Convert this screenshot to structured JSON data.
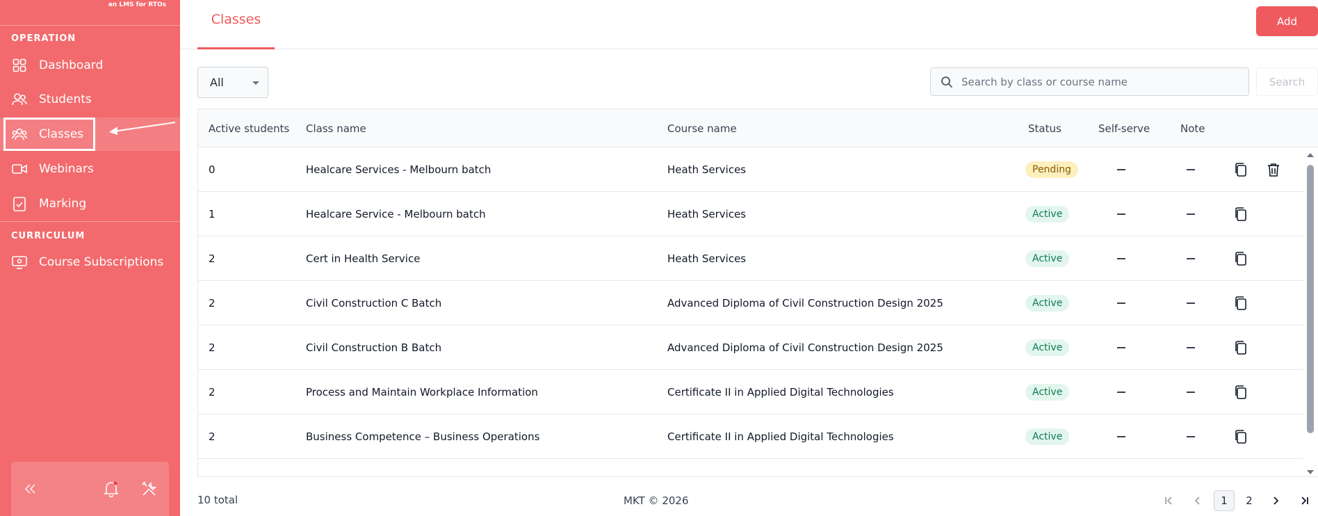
{
  "sidebar": {
    "brand_tag": "an LMS for RTOs",
    "sections": [
      {
        "label": "OPERATION"
      },
      {
        "label": "CURRICULUM"
      }
    ],
    "items": [
      {
        "label": "Dashboard",
        "icon": "grid-icon"
      },
      {
        "label": "Students",
        "icon": "users-icon"
      },
      {
        "label": "Classes",
        "icon": "group-icon"
      },
      {
        "label": "Webinars",
        "icon": "video-icon"
      },
      {
        "label": "Marking",
        "icon": "clipboard-check-icon"
      },
      {
        "label": "Course Subscriptions",
        "icon": "monitor-icon"
      }
    ],
    "active_item": "Classes"
  },
  "header": {
    "tab": "Classes",
    "add_label": "Add"
  },
  "filters": {
    "status_selected": "All",
    "search_placeholder": "Search by class or course name",
    "search_label": "Search"
  },
  "table": {
    "columns": [
      "Active students",
      "Class name",
      "Course name",
      "Status",
      "Self-serve",
      "Note"
    ],
    "rows": [
      {
        "active": "0",
        "class": "Healcare Services - Melbourn batch",
        "course": "Heath Services",
        "status": "Pending"
      },
      {
        "active": "1",
        "class": "Healcare Service - Melbourn batch",
        "course": "Heath Services",
        "status": "Active"
      },
      {
        "active": "2",
        "class": "Cert in Health Service",
        "course": "Heath Services",
        "status": "Active"
      },
      {
        "active": "2",
        "class": "Civil Construction C Batch",
        "course": "Advanced Diploma of Civil Construction Design 2025",
        "status": "Active"
      },
      {
        "active": "2",
        "class": "Civil Construction B Batch",
        "course": "Advanced Diploma of Civil Construction Design 2025",
        "status": "Active"
      },
      {
        "active": "2",
        "class": "Process and Maintain Workplace Information",
        "course": "Certificate II in Applied Digital Technologies",
        "status": "Active"
      },
      {
        "active": "2",
        "class": "Business Competence – Business Operations",
        "course": "Certificate II in Applied Digital Technologies",
        "status": "Active"
      }
    ]
  },
  "footer": {
    "total": "10 total",
    "copyright": "MKT © 2026",
    "pages": [
      "1",
      "2"
    ],
    "current_page": "1"
  },
  "colors": {
    "brand": "#f26a6d",
    "accent": "#ee5a5e",
    "pending_bg": "#fdf0bf",
    "active_bg": "#e2f6ee"
  }
}
